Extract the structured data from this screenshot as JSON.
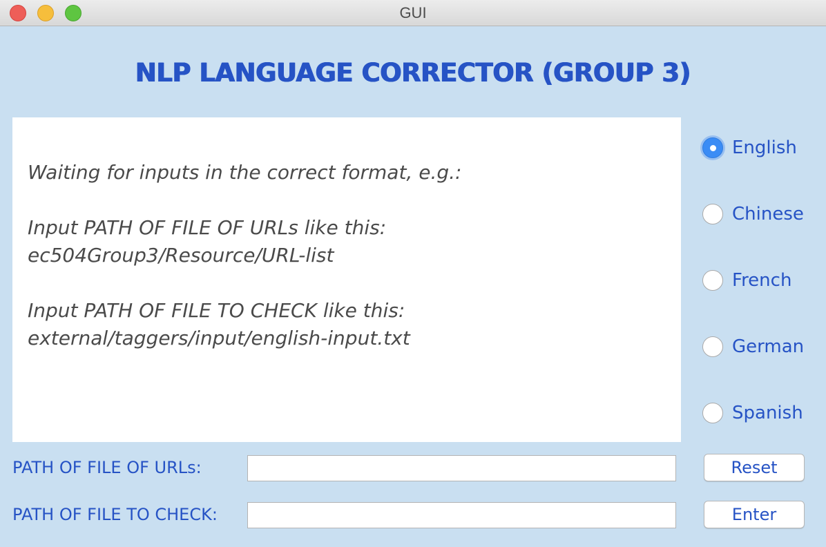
{
  "window": {
    "title": "GUI"
  },
  "header": {
    "title": "NLP LANGUAGE CORRECTOR (GROUP 3)"
  },
  "output": {
    "lines": [
      "Waiting for inputs in the correct format, e.g.:",
      "Input PATH OF FILE OF URLs like this:",
      "ec504Group3/Resource/URL-list",
      "Input PATH OF FILE TO CHECK like this:",
      "external/taggers/input/english-input.txt"
    ]
  },
  "languages": {
    "selected": "English",
    "options": [
      {
        "label": "English"
      },
      {
        "label": "Chinese"
      },
      {
        "label": "French"
      },
      {
        "label": "German"
      },
      {
        "label": "Spanish"
      }
    ]
  },
  "form": {
    "urls_label": "PATH OF FILE OF URLs:",
    "urls_value": "",
    "check_label": "PATH OF FILE TO CHECK:",
    "check_value": "",
    "reset_label": "Reset",
    "enter_label": "Enter"
  },
  "colors": {
    "background": "#c9dff1",
    "accent_text": "#2653c5",
    "radio_selected": "#3b8cf5"
  }
}
